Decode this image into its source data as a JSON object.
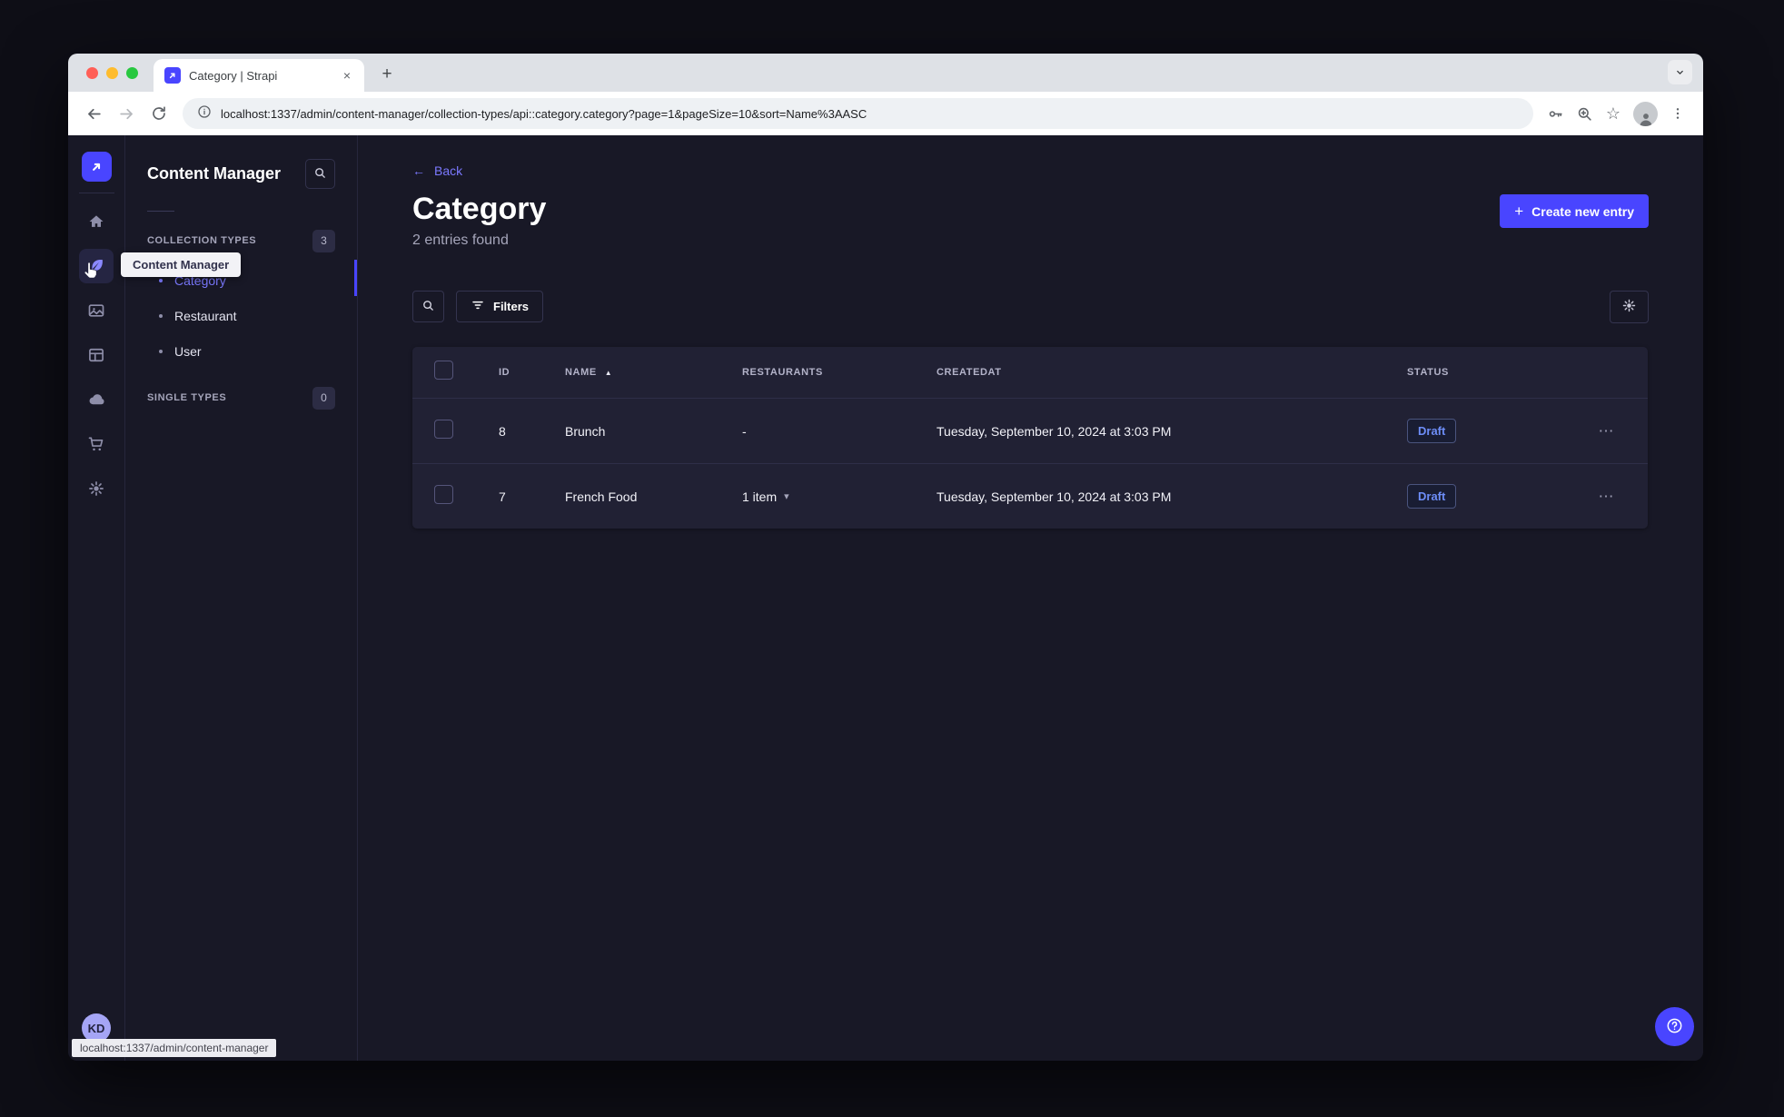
{
  "browser": {
    "tab_title": "Category | Strapi",
    "url": "localhost:1337/admin/content-manager/collection-types/api::category.category?page=1&pageSize=10&sort=Name%3AASC",
    "status_bar": "localhost:1337/admin/content-manager"
  },
  "glyphs": {
    "close": "×",
    "plus": "+",
    "back_arrow": "←",
    "sort_asc": "▲",
    "chevron_down": "▾",
    "dots": "⋯",
    "star": "☆"
  },
  "rail": {
    "active_item": "content-manager",
    "avatar_initials": "KD"
  },
  "subnav": {
    "title": "Content Manager",
    "sections": [
      {
        "label": "COLLECTION TYPES",
        "badge": "3"
      },
      {
        "label": "SINGLE TYPES",
        "badge": "0"
      }
    ],
    "items": [
      {
        "label": "Category",
        "active": true
      },
      {
        "label": "Restaurant",
        "active": false
      },
      {
        "label": "User",
        "active": false
      }
    ]
  },
  "tooltip": {
    "label": "Content Manager"
  },
  "main": {
    "back_label": "Back",
    "title": "Category",
    "subtitle": "2 entries found",
    "create_button_label": "Create new entry",
    "filters_button_label": "Filters",
    "table": {
      "headers": [
        "ID",
        "NAME",
        "RESTAURANTS",
        "CREATEDAT",
        "STATUS"
      ],
      "sorted_by": "NAME",
      "rows": [
        {
          "id": "8",
          "name": "Brunch",
          "restaurants": "-",
          "createdAt": "Tuesday, September 10, 2024 at 3:03 PM",
          "status": "Draft"
        },
        {
          "id": "7",
          "name": "French Food",
          "restaurants": "1 item",
          "createdAt": "Tuesday, September 10, 2024 at 3:03 PM",
          "status": "Draft"
        }
      ]
    }
  },
  "colors": {
    "primary": "#4945ff",
    "primary_light": "#7b79ff",
    "draft_text": "#6d8df7",
    "app_bg": "#181826",
    "card_bg": "#212134"
  }
}
